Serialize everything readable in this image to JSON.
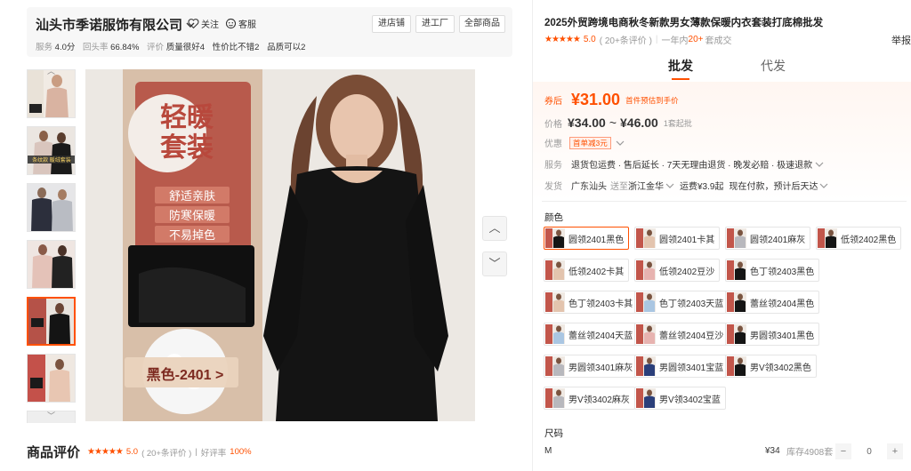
{
  "shop": {
    "name": "汕头市季诺服饰有限公司",
    "follow": "关注",
    "service": "客服",
    "buttons": [
      "进店铺",
      "进工厂",
      "全部商品"
    ],
    "stats": [
      {
        "label": "服务",
        "value": "4.0分"
      },
      {
        "label": "回头率",
        "value": "66.84%"
      },
      {
        "label": "评价",
        "value": "质量很好4"
      },
      {
        "label": "",
        "value": "性价比不错2"
      },
      {
        "label": "",
        "value": "品质可以2"
      }
    ]
  },
  "banner": {
    "headline1": "轻暖",
    "headline2": "套装",
    "features": [
      "舒适亲肤",
      "防寒保暖",
      "不易掉色"
    ],
    "colorbox": "黑色-2401 >"
  },
  "thumb_text": {
    "t2": "条纹款 暖绒套装"
  },
  "review": {
    "title": "商品评价",
    "score": "5.0",
    "count": "( 20+条评价 )",
    "sep": "|",
    "good_label": "好评率",
    "good_rate": "100%"
  },
  "product": {
    "title": "2025外贸跨境电商秋冬新款男女薄款保暖内衣套装打底棉批发",
    "score": "5.0",
    "count": "( 20+条评价 )",
    "sold_prefix": "一年内",
    "sold_num": "20+",
    "sold_suffix": "套成交",
    "report": "举报"
  },
  "tabs": [
    "批发",
    "代发"
  ],
  "price": {
    "coupon_label": "券后",
    "coupon_price": "¥31.00",
    "coupon_note": "首件预估到手价",
    "price_label": "价格",
    "range_low": "¥34.00",
    "range_sep": "~",
    "range_high": "¥46.00",
    "moq": "1套起批",
    "discount_label": "优惠",
    "discount_tag": "首单减3元",
    "service_label": "服务",
    "service_text": "退货包运费 · 售后延长 · 7天无理由退货 · 晚发必赔 · 极速退款",
    "ship_label": "发货",
    "ship_text": "广东汕头",
    "ship_to_pre": "送至",
    "ship_to": "浙江金华",
    "freight": "运费¥3.9起",
    "ship_time": "现在付款，预计后天达"
  },
  "color": {
    "label": "颜色",
    "options": [
      "圆领2401黑色",
      "圆领2401卡其",
      "圆领2401麻灰",
      "低领2402黑色",
      "低领2402卡其",
      "低领2402豆沙",
      "色丁领2403黑色",
      "色丁领2403卡其",
      "色丁领2403天蓝",
      "蕾丝领2404黑色",
      "蕾丝领2404天蓝",
      "蕾丝领2404豆沙",
      "男圆领3401黑色",
      "男圆领3401麻灰",
      "男圆领3401宝蓝",
      "男V领3402黑色",
      "男V领3402麻灰",
      "男V领3402宝蓝"
    ],
    "selected": "圆领2401黑色"
  },
  "size": {
    "label": "尺码",
    "option": "M",
    "price": "¥34",
    "stock": "库存4908套",
    "qty": "0",
    "minus": "−",
    "plus": "+"
  }
}
